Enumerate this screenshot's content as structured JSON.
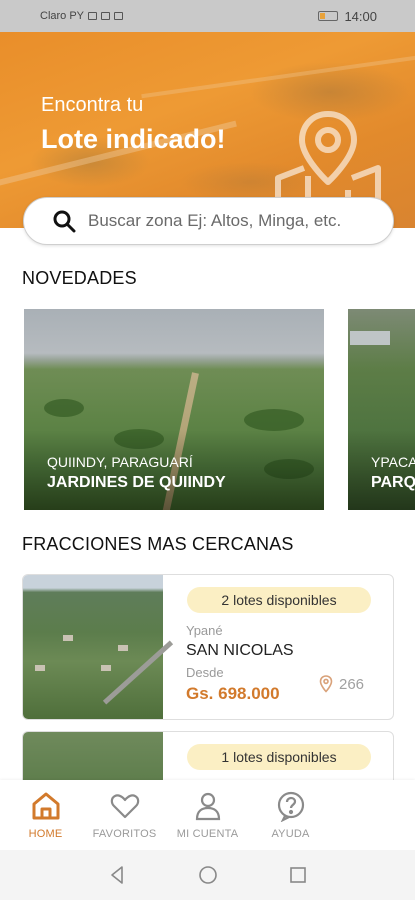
{
  "status_bar": {
    "carrier": "Claro PY",
    "time": "14:00"
  },
  "hero": {
    "subtitle": "Encontra tu",
    "title": "Lote indicado!",
    "icon": "map-location-icon"
  },
  "search": {
    "placeholder": "Buscar zona Ej: Altos, Minga, etc.",
    "value": ""
  },
  "sections": {
    "news_title": "NOVEDADES",
    "nearby_title": "FRACCIONES MAS CERCANAS"
  },
  "novedades": [
    {
      "place": "QUIINDY, PARAGUARÍ",
      "name": "JARDINES DE QUIINDY"
    },
    {
      "place": "YPACA",
      "name": "PARQU"
    }
  ],
  "fracciones": [
    {
      "badge": "2 lotes disponibles",
      "city": "Ypané",
      "name": "SAN NICOLAS",
      "from_label": "Desde",
      "price": "Gs. 698.000",
      "distance": "266"
    },
    {
      "badge": "1 lotes disponibles"
    }
  ],
  "nav": [
    {
      "label": "HOME",
      "icon": "home-icon",
      "active": true
    },
    {
      "label": "FAVORITOS",
      "icon": "heart-icon",
      "active": false
    },
    {
      "label": "MI CUENTA",
      "icon": "user-icon",
      "active": false
    },
    {
      "label": "AYUDA",
      "icon": "help-icon",
      "active": false
    }
  ],
  "colors": {
    "accent": "#d27a2c",
    "hero": "#e98e2a",
    "badge": "#fbefc4"
  }
}
